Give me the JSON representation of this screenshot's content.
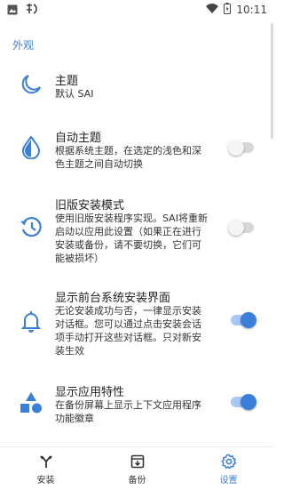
{
  "status_bar": {
    "time": "10:11",
    "icons": [
      "image-icon",
      "app-logo-icon",
      "wifi-icon",
      "battery-icon"
    ]
  },
  "section": {
    "title": "外观"
  },
  "prefs": [
    {
      "icon": "moon-icon",
      "title": "主题",
      "summary": "默认 SAI"
    },
    {
      "icon": "drop-icon",
      "title": "自动主题",
      "summary": "根据系统主题，在选定的浅色和深色主题之间自动切换",
      "toggle": "off"
    },
    {
      "icon": "history-icon",
      "title": "旧版安装模式",
      "summary": "使用旧版安装程序实现。SAI将重新启动以应用此设置（如果正在进行安装或备份，请不要切换，它们可能被损坏）",
      "toggle": "off"
    },
    {
      "icon": "bell-icon",
      "title": "显示前台系统安装界面",
      "summary": "无论安装成功与否，一律显示安装对话框。您可以通过点击安装会话项手动打开这些对话框。只对新安装生效",
      "toggle": "on"
    },
    {
      "icon": "shapes-icon",
      "title": "显示应用特性",
      "summary": "在备份屏幕上显示上下文应用程序功能徽章",
      "toggle": "on"
    }
  ],
  "bottom_nav": {
    "items": [
      {
        "icon": "install-icon",
        "label": "安装"
      },
      {
        "icon": "backup-icon",
        "label": "备份"
      },
      {
        "icon": "settings-gear-icon",
        "label": "设置",
        "active": true
      }
    ]
  },
  "colors": {
    "accent": "#3a7fd9"
  }
}
